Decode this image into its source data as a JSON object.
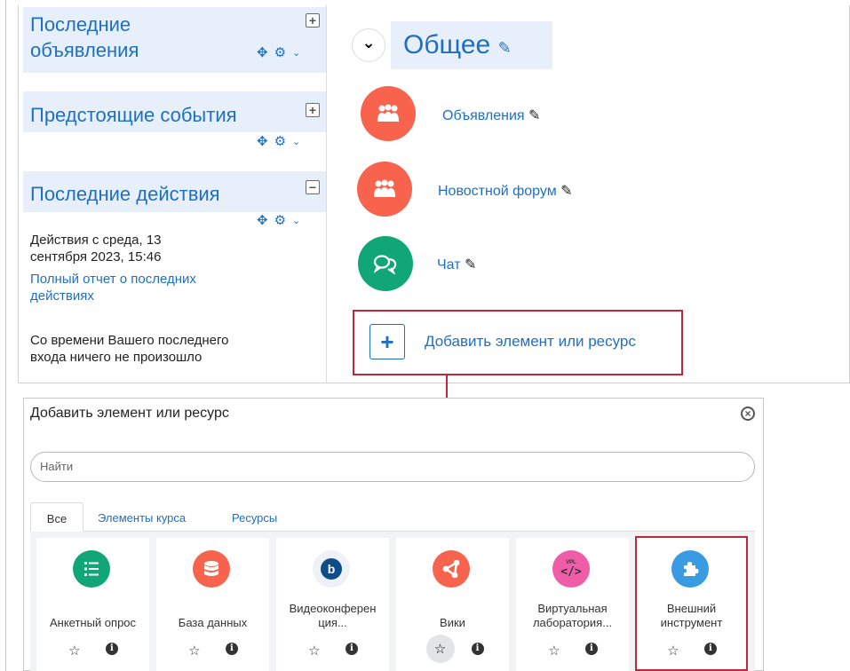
{
  "blocks": {
    "news": {
      "title_line1": "Последние",
      "title_line2": "объявления"
    },
    "events": {
      "title": "Предстоящие события"
    },
    "recent": {
      "title": "Последние действия",
      "since_line1": "Действия с среда, 13",
      "since_line2": "сентября 2023, 15:46",
      "report_line1": "Полный отчет о последних",
      "report_line2": "действиях",
      "nothing_line1": "Со времени Вашего последнего",
      "nothing_line2": "входа ничего не произошло"
    },
    "icons": {
      "add": "plus-square-icon",
      "collapse": "minus-square-icon",
      "move": "move-icon",
      "settings": "gear-icon",
      "menu": "chevron-down-icon"
    }
  },
  "section": {
    "title": "Общее",
    "activities": [
      {
        "name": "Объявления",
        "icon": "forum-icon",
        "color": "#f7634d"
      },
      {
        "name": "Новостной форум",
        "icon": "forum-icon",
        "color": "#f7634d"
      },
      {
        "name": "Чат",
        "icon": "chat-icon",
        "color": "#11a676"
      }
    ],
    "add_label": "Добавить элемент или ресурс"
  },
  "modal": {
    "title": "Добавить элемент или ресурс",
    "search_placeholder": "Найти",
    "tabs": [
      "Все",
      "Элементы курса",
      "Ресурсы"
    ],
    "active_tab": "Все",
    "cards": [
      {
        "line1": "Анкетный опрос",
        "line2": "",
        "icon": "list-icon",
        "color": "#11a676"
      },
      {
        "line1": "База данных",
        "line2": "",
        "icon": "database-icon",
        "color": "#f7634d"
      },
      {
        "line1": "Видеоконферен",
        "line2": "ция...",
        "icon": "bigbluebutton-icon",
        "color": "#0f4d8a"
      },
      {
        "line1": "Вики",
        "line2": "",
        "icon": "wiki-icon",
        "color": "#f7634d"
      },
      {
        "line1": "Виртуальная",
        "line2": "лаборатория...",
        "icon": "vpl-icon",
        "color": "#ef5da8"
      },
      {
        "line1": "Внешний",
        "line2": "инструмент",
        "icon": "puzzle-icon",
        "color": "#399be2"
      }
    ],
    "card_icons": {
      "star": "star-icon",
      "info": "info-icon"
    }
  },
  "colors": {
    "link": "#1f6fc2",
    "highlight": "#c1273b",
    "block_bg": "#e7f0fa"
  }
}
